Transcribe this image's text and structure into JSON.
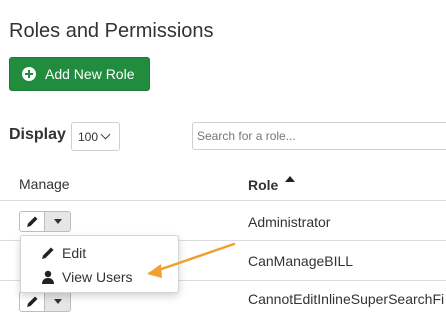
{
  "page": {
    "title": "Roles and Permissions"
  },
  "toolbar": {
    "add_label": "Add New Role"
  },
  "display": {
    "label": "Display",
    "selected": "100"
  },
  "search": {
    "placeholder": "Search for a role..."
  },
  "table": {
    "headers": {
      "manage": "Manage",
      "role": "Role"
    },
    "sort": {
      "column": "Role",
      "direction": "ascending"
    },
    "rows": [
      {
        "role": "Administrator"
      },
      {
        "role": "CanManageBILL"
      },
      {
        "role": "CannotEditInlineSuperSearchFi"
      }
    ]
  },
  "dropdown": {
    "items": [
      {
        "label": "Edit",
        "icon": "pencil-icon"
      },
      {
        "label": "View Users",
        "icon": "user-icon"
      }
    ]
  },
  "colors": {
    "accent": "#218c3d",
    "annotation": "#f0a030"
  }
}
